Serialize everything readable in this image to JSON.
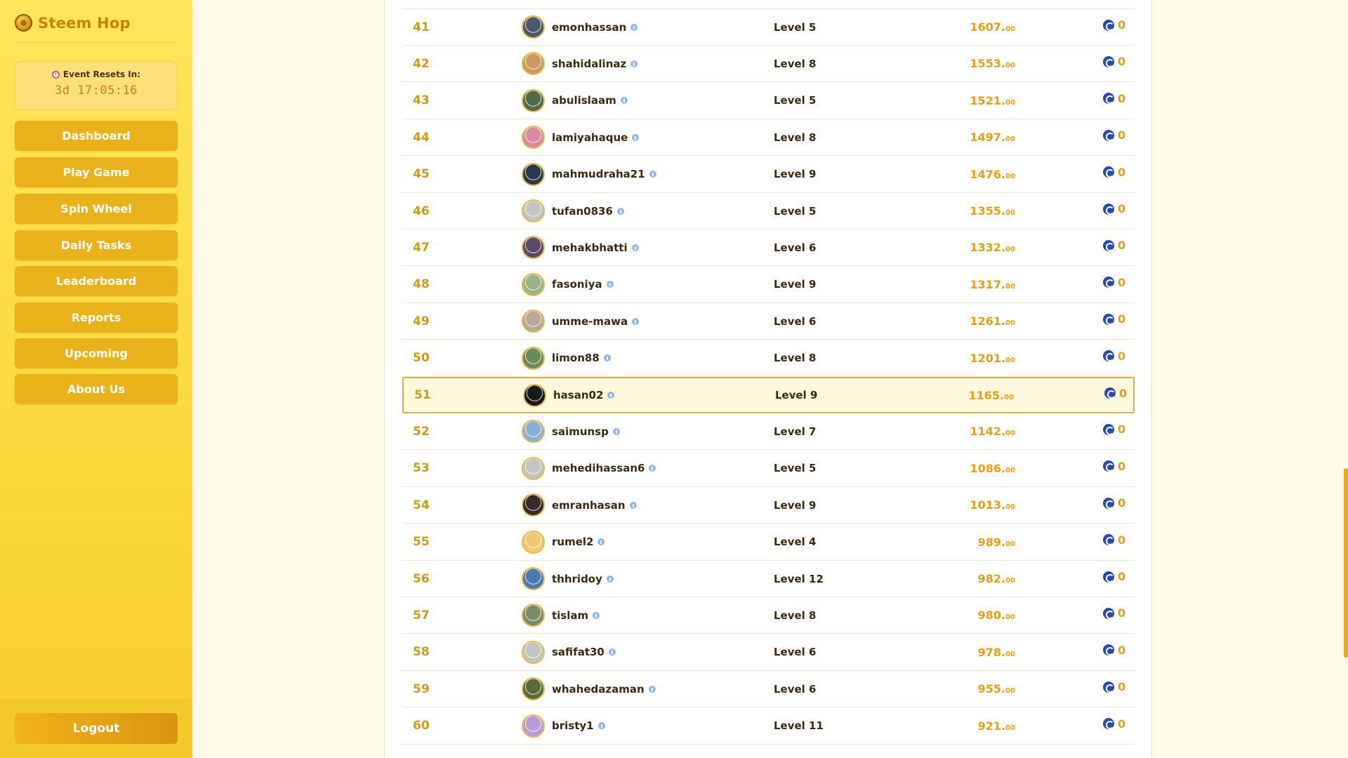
{
  "brand": {
    "name": "Steem Hop"
  },
  "timer": {
    "label": "Event Resets In:",
    "value": "3d 17:05:16"
  },
  "nav": [
    {
      "label": "Dashboard"
    },
    {
      "label": "Play Game"
    },
    {
      "label": "Spin Wheel"
    },
    {
      "label": "Daily Tasks"
    },
    {
      "label": "Leaderboard"
    },
    {
      "label": "Reports"
    },
    {
      "label": "Upcoming"
    },
    {
      "label": "About Us"
    }
  ],
  "logout": {
    "label": "Logout"
  },
  "leaderboard": {
    "rows": [
      {
        "rank": "41",
        "user": "emonhassan",
        "level": "Level 5",
        "score": "1607.",
        "decimals": "00",
        "reward": "0",
        "avatar": "#4a5a6a"
      },
      {
        "rank": "42",
        "user": "shahidalinaz",
        "level": "Level 8",
        "score": "1553.",
        "decimals": "00",
        "reward": "0",
        "avatar": "#c89a62"
      },
      {
        "rank": "43",
        "user": "abulislaam",
        "level": "Level 5",
        "score": "1521.",
        "decimals": "00",
        "reward": "0",
        "avatar": "#536a4a"
      },
      {
        "rank": "44",
        "user": "lamiyahaque",
        "level": "Level 8",
        "score": "1497.",
        "decimals": "00",
        "reward": "0",
        "avatar": "#d98aa0"
      },
      {
        "rank": "45",
        "user": "mahmudraha21",
        "level": "Level 9",
        "score": "1476.",
        "decimals": "00",
        "reward": "0",
        "avatar": "#2a3a4a"
      },
      {
        "rank": "46",
        "user": "tufan0836",
        "level": "Level 5",
        "score": "1355.",
        "decimals": "00",
        "reward": "0",
        "avatar": "#c4c4c4"
      },
      {
        "rank": "47",
        "user": "mehakbhatti",
        "level": "Level 6",
        "score": "1332.",
        "decimals": "00",
        "reward": "0",
        "avatar": "#5a4a6a"
      },
      {
        "rank": "48",
        "user": "fasoniya",
        "level": "Level 9",
        "score": "1317.",
        "decimals": "00",
        "reward": "0",
        "avatar": "#9ab48a"
      },
      {
        "rank": "49",
        "user": "umme-mawa",
        "level": "Level 6",
        "score": "1261.",
        "decimals": "00",
        "reward": "0",
        "avatar": "#b8a89a"
      },
      {
        "rank": "50",
        "user": "limon88",
        "level": "Level 8",
        "score": "1201.",
        "decimals": "00",
        "reward": "0",
        "avatar": "#6a8a5a"
      },
      {
        "rank": "51",
        "user": "hasan02",
        "level": "Level 9",
        "score": "1165.",
        "decimals": "00",
        "reward": "0",
        "avatar": "#1a1a1a",
        "highlight": true
      },
      {
        "rank": "52",
        "user": "saimunsp",
        "level": "Level 7",
        "score": "1142.",
        "decimals": "00",
        "reward": "0",
        "avatar": "#8ab0d8"
      },
      {
        "rank": "53",
        "user": "mehedihassan6",
        "level": "Level 5",
        "score": "1086.",
        "decimals": "00",
        "reward": "0",
        "avatar": "#c4c4c4"
      },
      {
        "rank": "54",
        "user": "emranhasan",
        "level": "Level 9",
        "score": "1013.",
        "decimals": "00",
        "reward": "0",
        "avatar": "#3a2a2a"
      },
      {
        "rank": "55",
        "user": "rumel2",
        "level": "Level 4",
        "score": "989.",
        "decimals": "00",
        "reward": "0",
        "avatar": "#f0c870"
      },
      {
        "rank": "56",
        "user": "thhridoy",
        "level": "Level 12",
        "score": "982.",
        "decimals": "00",
        "reward": "0",
        "avatar": "#4a7ab0"
      },
      {
        "rank": "57",
        "user": "tislam",
        "level": "Level 8",
        "score": "980.",
        "decimals": "00",
        "reward": "0",
        "avatar": "#7a8a6a"
      },
      {
        "rank": "58",
        "user": "safifat30",
        "level": "Level 6",
        "score": "978.",
        "decimals": "00",
        "reward": "0",
        "avatar": "#c4c4c4"
      },
      {
        "rank": "59",
        "user": "whahedazaman",
        "level": "Level 6",
        "score": "955.",
        "decimals": "00",
        "reward": "0",
        "avatar": "#5a6a3a"
      },
      {
        "rank": "60",
        "user": "bristy1",
        "level": "Level 11",
        "score": "921.",
        "decimals": "00",
        "reward": "0",
        "avatar": "#b89ad8"
      }
    ]
  },
  "colors": {
    "accent": "#e0a21a",
    "sidebar": "#fbd93e",
    "steem": "#2a49b3",
    "highlight_border": "#d9b24a"
  },
  "icons": {
    "brand": "coin-logo-icon",
    "timer": "alarm-clock-icon",
    "verified": "info-icon",
    "reward": "steem-icon"
  }
}
